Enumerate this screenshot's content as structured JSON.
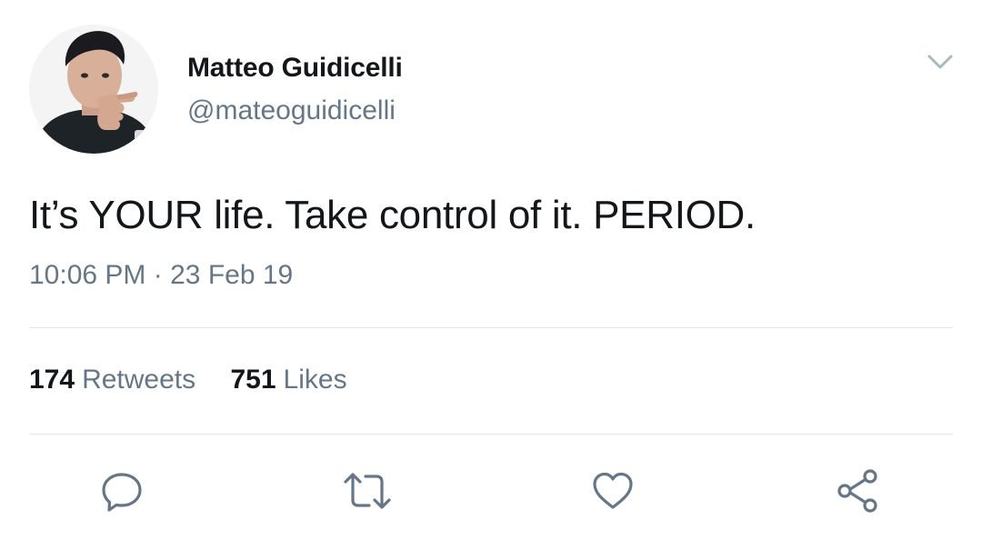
{
  "author": {
    "name": "Matteo Guidicelli",
    "handle": "@mateoguidicelli"
  },
  "tweet": {
    "text": "It’s YOUR life. Take control of it. PERIOD.",
    "time": "10:06 PM",
    "separator": "·",
    "date": "23 Feb 19"
  },
  "stats": {
    "retweets_count": "174",
    "retweets_label": "Retweets",
    "likes_count": "751",
    "likes_label": "Likes"
  },
  "icons": {
    "menu": "chevron-down-icon",
    "reply": "reply-icon",
    "retweet": "retweet-icon",
    "like": "heart-icon",
    "share": "share-icon"
  },
  "colors": {
    "text_primary": "#14171a",
    "text_secondary": "#657786",
    "icon": "#657786",
    "divider": "#e1e8ed"
  }
}
